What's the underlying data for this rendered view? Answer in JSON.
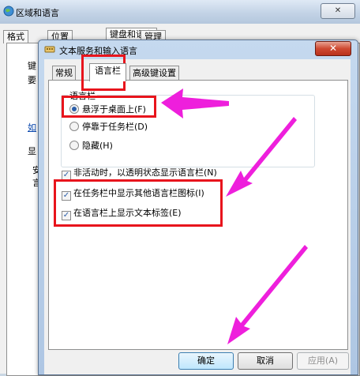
{
  "outer_window": {
    "title": "区域和语言",
    "close_glyph": "✕",
    "tabs": [
      "格式",
      "位置",
      "键盘和语言",
      "管理"
    ],
    "peek_text": [
      "键",
      "要",
      "如",
      "显",
      "安",
      "言"
    ]
  },
  "dialog": {
    "title": "文本服务和输入语言",
    "close_glyph": "✕",
    "tabs": [
      "常规",
      "语言栏",
      "高级键设置"
    ],
    "language_bar_group": {
      "legend": "语言栏",
      "options": [
        {
          "label": "悬浮于桌面上(F)",
          "selected": true
        },
        {
          "label": "停靠于任务栏(D)",
          "selected": false
        },
        {
          "label": "隐藏(H)",
          "selected": false
        }
      ]
    },
    "checkboxes": [
      {
        "label": "非活动时，以透明状态显示语言栏(N)",
        "checked": true
      },
      {
        "label": "在任务栏中显示其他语言栏图标(I)",
        "checked": true
      },
      {
        "label": "在语言栏上显示文本标签(E)",
        "checked": true
      }
    ],
    "buttons": {
      "ok": "确定",
      "cancel": "取消",
      "apply": "应用(A)"
    }
  },
  "annotations": {
    "highlight_color": "#e8141c",
    "arrow_color": "#ee1fdc"
  },
  "check_glyph": "✓"
}
